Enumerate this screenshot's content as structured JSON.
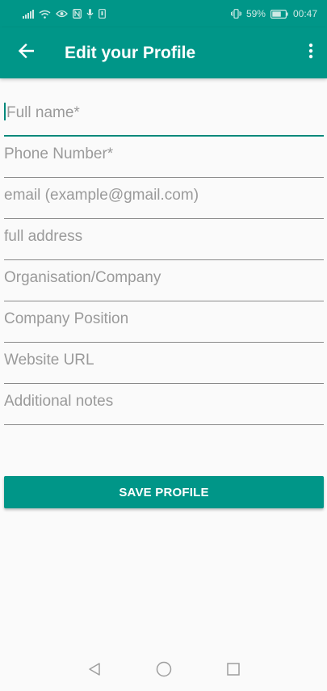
{
  "status_bar": {
    "battery_percent": "59%",
    "time": "00:47",
    "left_icons": [
      "signal-icon",
      "wifi-icon",
      "eye-icon",
      "nfc-icon",
      "mic-icon",
      "sim-icon"
    ],
    "right_icons": [
      "vibrate-icon",
      "battery-icon"
    ]
  },
  "app_bar": {
    "title": "Edit your Profile",
    "back_icon": "arrow-left-icon",
    "menu_icon": "more-vert-icon"
  },
  "form": {
    "fields": [
      {
        "name": "full-name-field",
        "placeholder": "Full name*",
        "value": ""
      },
      {
        "name": "phone-number-field",
        "placeholder": "Phone Number*",
        "value": ""
      },
      {
        "name": "email-field",
        "placeholder": "email (example@gmail.com)",
        "value": ""
      },
      {
        "name": "address-field",
        "placeholder": "full address",
        "value": ""
      },
      {
        "name": "organisation-field",
        "placeholder": "Organisation/Company",
        "value": ""
      },
      {
        "name": "position-field",
        "placeholder": "Company Position",
        "value": ""
      },
      {
        "name": "website-field",
        "placeholder": "Website URL",
        "value": ""
      },
      {
        "name": "notes-field",
        "placeholder": "Additional notes",
        "value": ""
      }
    ],
    "save_label": "SAVE PROFILE"
  },
  "nav_bar": {
    "icons": [
      "back-triangle-icon",
      "home-circle-icon",
      "recents-square-icon"
    ]
  },
  "colors": {
    "primary": "#009688",
    "accent": "#00897b",
    "background": "#fafafa"
  }
}
